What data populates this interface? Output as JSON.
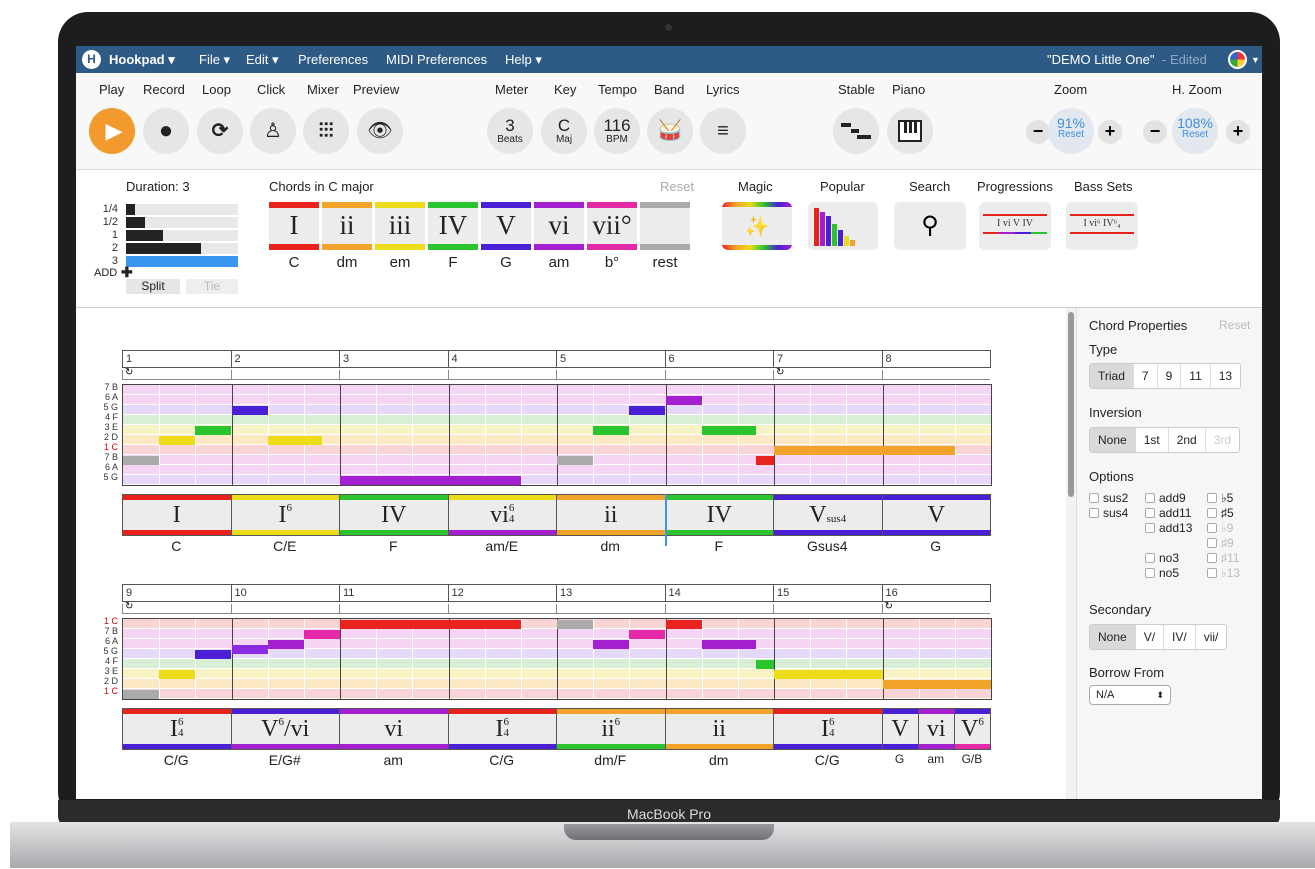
{
  "menubar": {
    "app": "Hookpad ▾",
    "items": [
      "File ▾",
      "Edit ▾",
      "Preferences",
      "MIDI Preferences",
      "Help ▾"
    ],
    "doc_title": "\"DEMO Little One\"",
    "doc_status": "- Edited"
  },
  "toolbar": {
    "labels": {
      "play": "Play",
      "record": "Record",
      "loop": "Loop",
      "click": "Click",
      "mixer": "Mixer",
      "preview": "Preview",
      "meter": "Meter",
      "key": "Key",
      "tempo": "Tempo",
      "band": "Band",
      "lyrics": "Lyrics",
      "stable": "Stable",
      "piano": "Piano",
      "zoom": "Zoom",
      "hzoom": "H. Zoom"
    },
    "meter": {
      "value": "3",
      "unit": "Beats"
    },
    "key": {
      "value": "C",
      "unit": "Maj"
    },
    "tempo": {
      "value": "116",
      "unit": "BPM"
    },
    "zoom": {
      "value": "91%",
      "reset": "Reset"
    },
    "hzoom": {
      "value": "108%",
      "reset": "Reset"
    },
    "play_color": "#f39a2e"
  },
  "palette": {
    "duration_label": "Duration: 3",
    "durations": [
      {
        "label": "1/4",
        "level": 0.08
      },
      {
        "label": "1/2",
        "level": 0.17
      },
      {
        "label": "1",
        "level": 0.33
      },
      {
        "label": "2",
        "level": 0.67
      },
      {
        "label": "3",
        "level": 1.0,
        "selected": true
      }
    ],
    "add_label": "ADD",
    "split": "Split",
    "tie": "Tie",
    "chords_title": "Chords in C major",
    "reset": "Reset",
    "chords": [
      {
        "roman": "I",
        "name": "C",
        "color": "#e8231e"
      },
      {
        "roman": "ii",
        "name": "dm",
        "color": "#f2a42a"
      },
      {
        "roman": "iii",
        "name": "em",
        "color": "#ecdc1a"
      },
      {
        "roman": "IV",
        "name": "F",
        "color": "#29c42e"
      },
      {
        "roman": "V",
        "name": "G",
        "color": "#4a1fd6"
      },
      {
        "roman": "vi",
        "name": "am",
        "color": "#a41fd0"
      },
      {
        "roman": "vii°",
        "name": "b°",
        "color": "#e52aa8"
      },
      {
        "roman": "",
        "name": "rest",
        "color": "#aaaaaa"
      }
    ],
    "tools": [
      "Magic",
      "Popular",
      "Search",
      "Progressions",
      "Bass Sets"
    ],
    "progression_text": "I vi V IV",
    "bassset_text": "I vi⁶ IV⁶₄"
  },
  "editor": {
    "row_labels_top": [
      "7 B",
      "6 A",
      "5 G",
      "4 F",
      "3 E",
      "2 D",
      "1 C",
      "7 B",
      "6 A",
      "5 G"
    ],
    "row_labels_bottom": [
      "1 C",
      "7 B",
      "6 A",
      "5 G",
      "4 F",
      "3 E",
      "2 D",
      "1 C"
    ],
    "systems": [
      {
        "bars": [
          "1",
          "2",
          "3",
          "4",
          "5",
          "6",
          "7",
          "8"
        ],
        "chords": [
          {
            "roman": "I",
            "sup": "",
            "sub": "",
            "name": "C",
            "top": "#e8231e",
            "bottom": "#e8231e",
            "beats": 3
          },
          {
            "roman": "I",
            "sup": "6",
            "sub": "",
            "name": "C/E",
            "top": "#ecdc1a",
            "bottom": "#ecdc1a",
            "beats": 3
          },
          {
            "roman": "IV",
            "sup": "",
            "sub": "",
            "name": "F",
            "top": "#29c42e",
            "bottom": "#29c42e",
            "beats": 3
          },
          {
            "roman": "vi",
            "sup": "6",
            "sub": "4",
            "name": "am/E",
            "top": "#ecdc1a",
            "bottom": "#a41fd0",
            "beats": 3
          },
          {
            "roman": "ii",
            "sup": "",
            "sub": "",
            "name": "dm",
            "top": "#f2a42a",
            "bottom": "#f2a42a",
            "beats": 3
          },
          {
            "roman": "IV",
            "sup": "",
            "sub": "",
            "name": "F",
            "top": "#29c42e",
            "bottom": "#29c42e",
            "beats": 3
          },
          {
            "roman": "V",
            "sup": "",
            "sub": "sus4",
            "name": "Gsus4",
            "top": "#4a1fd6",
            "bottom": "#4a1fd6",
            "beats": 3
          },
          {
            "roman": "V",
            "sup": "",
            "sub": "",
            "name": "G",
            "top": "#4a1fd6",
            "bottom": "#4a1fd6",
            "beats": 3
          }
        ],
        "notes": [
          {
            "start": 0,
            "len": 1,
            "row": 7,
            "color": "#aaaaaa"
          },
          {
            "start": 1,
            "len": 1,
            "row": 5,
            "color": "#ecdc1a"
          },
          {
            "start": 2,
            "len": 1,
            "row": 4,
            "color": "#29c42e"
          },
          {
            "start": 3,
            "len": 1,
            "row": 2,
            "color": "#4a1fd6"
          },
          {
            "start": 4,
            "len": 1.5,
            "row": 5,
            "color": "#ecdc1a"
          },
          {
            "start": 5.5,
            "len": 0.5,
            "row": 10,
            "color": "#4a1fd6"
          },
          {
            "start": 6,
            "len": 5,
            "row": 9,
            "color": "#a41fd0"
          },
          {
            "start": 12,
            "len": 1,
            "row": 7,
            "color": "#aaaaaa"
          },
          {
            "start": 13,
            "len": 1,
            "row": 4,
            "color": "#29c42e"
          },
          {
            "start": 14,
            "len": 1,
            "row": 2,
            "color": "#4a1fd6"
          },
          {
            "start": 15,
            "len": 1,
            "row": 1,
            "color": "#a41fd0"
          },
          {
            "start": 16,
            "len": 1.5,
            "row": 4,
            "color": "#29c42e"
          },
          {
            "start": 17.5,
            "len": 0.5,
            "row": 7,
            "color": "#e8231e"
          },
          {
            "start": 18,
            "len": 5,
            "row": 6,
            "color": "#f2a42a"
          }
        ]
      },
      {
        "bars": [
          "9",
          "10",
          "11",
          "12",
          "13",
          "14",
          "15",
          "16"
        ],
        "chords": [
          {
            "roman": "I",
            "sup": "6",
            "sub": "4",
            "name": "C/G",
            "top": "#e8231e",
            "bottom": "#4a1fd6",
            "beats": 3
          },
          {
            "roman": "V",
            "sup": "6",
            "sub": "",
            "suffix": "/vi",
            "name": "E/G#",
            "top": "#4a1fd6",
            "bottom": "#a41fd0",
            "beats": 3
          },
          {
            "roman": "vi",
            "sup": "",
            "sub": "",
            "name": "am",
            "top": "#a41fd0",
            "bottom": "#a41fd0",
            "beats": 3
          },
          {
            "roman": "I",
            "sup": "6",
            "sub": "4",
            "name": "C/G",
            "top": "#e8231e",
            "bottom": "#4a1fd6",
            "beats": 3
          },
          {
            "roman": "ii",
            "sup": "6",
            "sub": "",
            "name": "dm/F",
            "top": "#f2a42a",
            "bottom": "#29c42e",
            "beats": 3
          },
          {
            "roman": "ii",
            "sup": "",
            "sub": "",
            "name": "dm",
            "top": "#f2a42a",
            "bottom": "#f2a42a",
            "beats": 3
          },
          {
            "roman": "I",
            "sup": "6",
            "sub": "4",
            "name": "C/G",
            "top": "#e8231e",
            "bottom": "#4a1fd6",
            "beats": 3
          },
          {
            "roman": "V",
            "sup": "",
            "sub": "",
            "name": "G",
            "top": "#4a1fd6",
            "bottom": "#4a1fd6",
            "beats": 1
          },
          {
            "roman": "vi",
            "sup": "",
            "sub": "",
            "name": "am",
            "top": "#a41fd0",
            "bottom": "#a41fd0",
            "beats": 1
          },
          {
            "roman": "V",
            "sup": "6",
            "sub": "",
            "name": "G/B",
            "top": "#4a1fd6",
            "bottom": "#e52aa8",
            "beats": 1
          }
        ],
        "notes": [
          {
            "start": 0,
            "len": 1,
            "row": 7,
            "color": "#aaaaaa"
          },
          {
            "start": 1,
            "len": 1,
            "row": 5,
            "color": "#ecdc1a"
          },
          {
            "start": 2,
            "len": 1,
            "row": 3,
            "color": "#4a1fd6"
          },
          {
            "start": 3,
            "len": 1,
            "row": 2.5,
            "color": "#8a2be2"
          },
          {
            "start": 4,
            "len": 1,
            "row": 2,
            "color": "#a41fd0"
          },
          {
            "start": 5,
            "len": 1,
            "row": 1,
            "color": "#e52aa8"
          },
          {
            "start": 6,
            "len": 5,
            "row": 0,
            "color": "#e8231e"
          },
          {
            "start": 12,
            "len": 1,
            "row": 0,
            "color": "#aaaaaa"
          },
          {
            "start": 13,
            "len": 1,
            "row": 2,
            "color": "#a41fd0"
          },
          {
            "start": 14,
            "len": 1,
            "row": 1,
            "color": "#e52aa8"
          },
          {
            "start": 15,
            "len": 1,
            "row": 0,
            "color": "#e8231e"
          },
          {
            "start": 16,
            "len": 1.5,
            "row": 2,
            "color": "#a41fd0"
          },
          {
            "start": 17.5,
            "len": 0.5,
            "row": 4,
            "color": "#29c42e"
          },
          {
            "start": 18,
            "len": 3,
            "row": 5,
            "color": "#ecdc1a"
          },
          {
            "start": 21,
            "len": 3,
            "row": 6,
            "color": "#f2a42a"
          }
        ]
      }
    ]
  },
  "properties": {
    "title": "Chord Properties",
    "reset": "Reset",
    "type_label": "Type",
    "types": [
      "Triad",
      "7",
      "9",
      "11",
      "13"
    ],
    "inversion_label": "Inversion",
    "inversions": [
      "None",
      "1st",
      "2nd",
      "3rd"
    ],
    "options_label": "Options",
    "options": [
      [
        "sus2",
        "sus4"
      ],
      [
        "add9",
        "add11",
        "add13",
        "no3",
        "no5"
      ],
      [
        "♭5",
        "♯5",
        "♭9",
        "♯9",
        "♯11",
        "♭13"
      ]
    ],
    "secondary_label": "Secondary",
    "secondary": [
      "None",
      "V/",
      "IV/",
      "vii/"
    ],
    "borrow_label": "Borrow From",
    "borrow_value": "N/A"
  },
  "device": {
    "label": "MacBook Pro"
  }
}
